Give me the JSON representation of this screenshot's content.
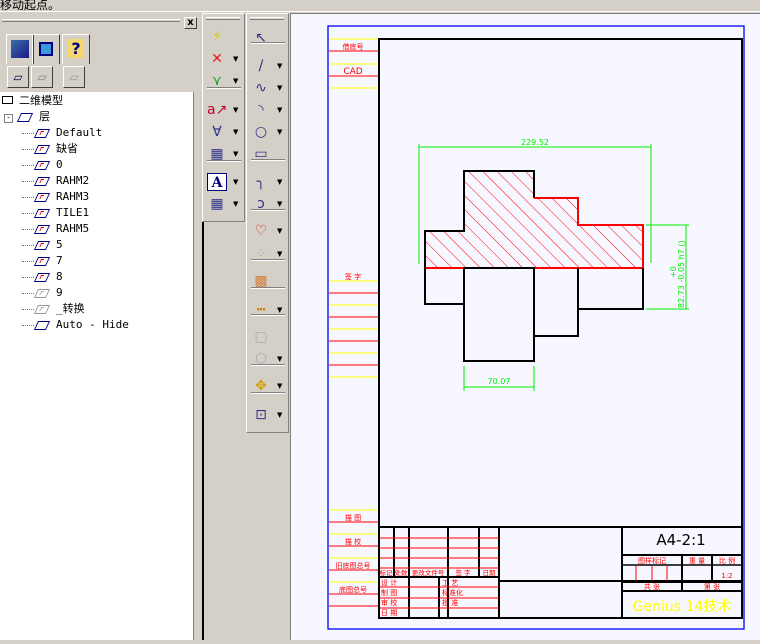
{
  "status_text": "移动起点。",
  "panel": {
    "close_label": "x",
    "tabs": [
      {
        "icon": "layers-book-icon"
      },
      {
        "icon": "objects-icon"
      },
      {
        "icon": "help-folder-icon"
      }
    ],
    "tree_buttons": [
      {
        "icon": "new-layer-icon"
      },
      {
        "icon": "layer-props-icon"
      },
      {
        "icon": "layer-delete-icon"
      }
    ],
    "root": "二维模型",
    "layers_node": "层",
    "layers": [
      {
        "name": "Default",
        "state": "on"
      },
      {
        "name": "缺省",
        "state": "on"
      },
      {
        "name": "0",
        "state": "on"
      },
      {
        "name": "RAHM2",
        "state": "on"
      },
      {
        "name": "RAHM3",
        "state": "on"
      },
      {
        "name": "TILE1",
        "state": "on"
      },
      {
        "name": "RAHM5",
        "state": "on"
      },
      {
        "name": "5",
        "state": "on"
      },
      {
        "name": "7",
        "state": "on"
      },
      {
        "name": "8",
        "state": "current"
      },
      {
        "name": "9",
        "state": "off"
      },
      {
        "name": "_转换",
        "state": "off"
      },
      {
        "name": "Auto - Hide",
        "state": "plain"
      }
    ]
  },
  "toolbar1": [
    "smart-dimension-icon",
    "linear-dimension-icon",
    "angle-dimension-icon",
    "annotation-icon",
    "surface-finish-icon",
    "datum-frame-icon",
    "text-icon",
    "table-icon"
  ],
  "toolbar2": [
    "select-icon",
    "line-icon",
    "spline-icon",
    "arc-icon",
    "circle-icon",
    "rectangle-icon",
    "fillet-icon",
    "offset-icon",
    "region-icon",
    "pattern-icon",
    "hatch-icon",
    "measure-icon",
    "edit-view-icon",
    "3d-view-icon",
    "move-icon",
    "insert-icon"
  ],
  "text_icon_glyph": "A",
  "drawing": {
    "colors": {
      "frame": "#0000ff",
      "part": "#000000",
      "hatch": "#ff0000",
      "dimension": "#00ee00",
      "label": "#ff0000",
      "strip": "#ffff00",
      "logo": "#ffff00"
    },
    "left_strip": {
      "top1": "借底号",
      "top2": "CAD",
      "middle": "签  字",
      "lower1": "描  图",
      "lower2": "描  校",
      "lower3": "旧底图总号",
      "lower4": "底图总号"
    },
    "dimensions": {
      "width": "229.52",
      "bottom": "70.07",
      "height": "82.73 -0.05  h7 ()",
      "height_upper": "+0"
    },
    "title_block": {
      "drawing_no": "A4-2:1",
      "rev_headers": [
        "标记",
        "处数",
        "更改文件号",
        "签 字",
        "日期"
      ],
      "sign_rows": [
        "设 计",
        "制 图",
        "审 校",
        "日 期"
      ],
      "sign_rows2": [
        "工 艺",
        "标准化",
        "批 准"
      ],
      "mark_label": "图样标记",
      "weight_label": "重 量",
      "scale_label": "比 例",
      "scale_value": "1:2",
      "sheets_total": "共    张",
      "sheet_no": "第    张",
      "company": "Genius 14技术"
    }
  }
}
